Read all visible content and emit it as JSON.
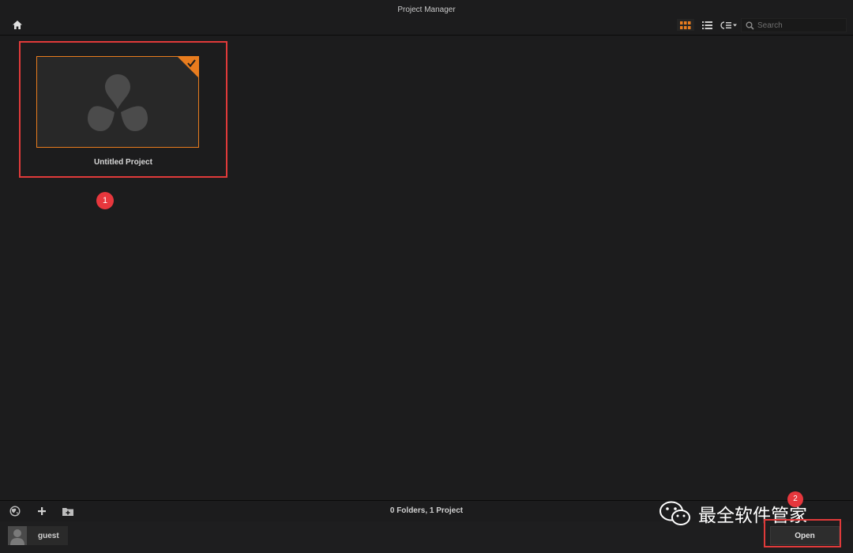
{
  "window": {
    "title": "Project Manager"
  },
  "toolbar": {
    "home_icon": "home-icon",
    "grid_view_icon": "grid-view-icon",
    "list_view_icon": "list-view-icon",
    "sort_icon": "sort-icon",
    "search_icon": "search-icon",
    "search_placeholder": "Search",
    "active_view": "grid"
  },
  "projects": [
    {
      "name": "Untitled Project",
      "selected": true,
      "thumbnail_icon": "resolve-logo-icon"
    }
  ],
  "annotations": {
    "marker_1": "1",
    "marker_2": "2",
    "highlight_color": "#e03a3a"
  },
  "status": {
    "summary": "0 Folders, 1 Project",
    "icons": [
      "globe-icon",
      "plus-icon",
      "new-folder-icon"
    ]
  },
  "footer": {
    "user_name": "guest",
    "open_label": "Open"
  },
  "watermark": {
    "text": "最全软件管家",
    "icon": "wechat-icon"
  },
  "colors": {
    "accent": "#e87c1e",
    "background": "#1c1c1d",
    "annotation": "#e03a3a"
  }
}
